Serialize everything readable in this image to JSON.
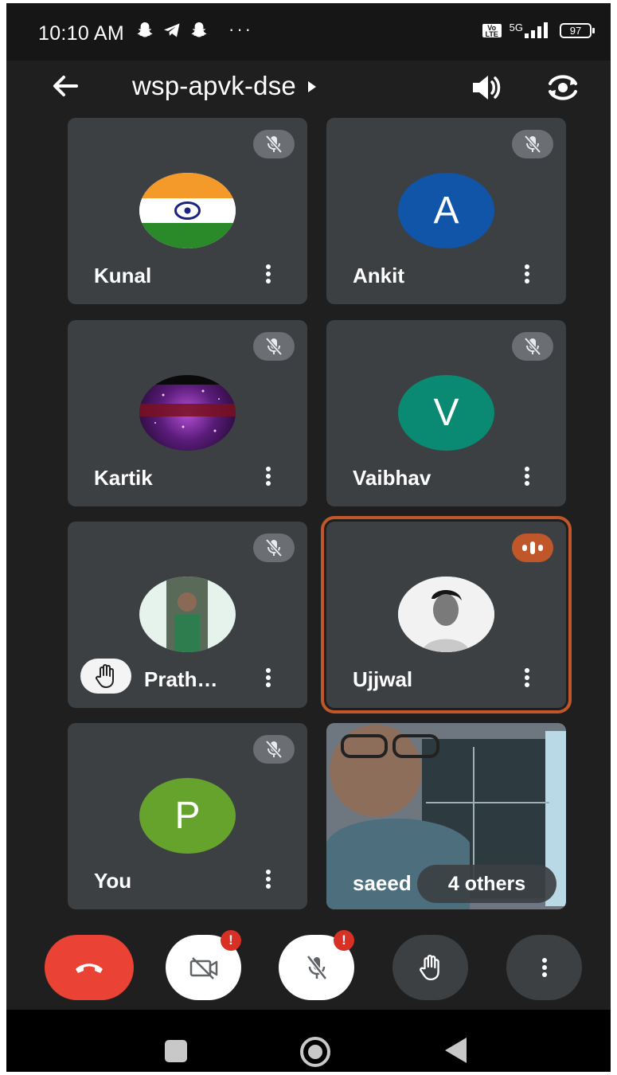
{
  "status_bar": {
    "time": "10:10 AM",
    "more_indicator": "···",
    "volte_label": "Vo\nLTE",
    "network_label": "5G",
    "battery": "97",
    "icons": [
      "snapchat-icon",
      "telegram-icon",
      "snapchat-icon",
      "signal-icon",
      "battery-icon"
    ]
  },
  "header": {
    "meeting_code": "wsp-apvk-dse",
    "icons": [
      "back-arrow-icon",
      "dropdown-triangle-icon",
      "speaker-icon",
      "camera-flip-icon"
    ]
  },
  "participants": [
    {
      "name": "Kunal",
      "avatar": "india-flag",
      "muted": true
    },
    {
      "name": "Ankit",
      "avatar_letter": "A",
      "avatar_color": "#1155a8",
      "muted": true
    },
    {
      "name": "Kartik",
      "avatar": "photo",
      "muted": true
    },
    {
      "name": "Vaibhav",
      "avatar_letter": "V",
      "avatar_color": "#0b8a73",
      "muted": true
    },
    {
      "name": "Prath…",
      "avatar": "photo",
      "muted": true,
      "hand_raised": true
    },
    {
      "name": "Ujjwal",
      "avatar": "photo",
      "muted": false,
      "speaking": true
    },
    {
      "name": "You",
      "avatar_letter": "P",
      "avatar_color": "#65a32c",
      "muted": true
    },
    {
      "name": "saeed",
      "video": true,
      "others_label": "4 others"
    }
  ],
  "controls": {
    "alert_mark": "!",
    "buttons": [
      "end-call",
      "camera-off",
      "mic-off",
      "raise-hand",
      "more-options"
    ],
    "end_call_color": "#ea4335"
  },
  "accent_colors": {
    "speaking": "#c0572a",
    "tile_bg": "#3c4043"
  }
}
